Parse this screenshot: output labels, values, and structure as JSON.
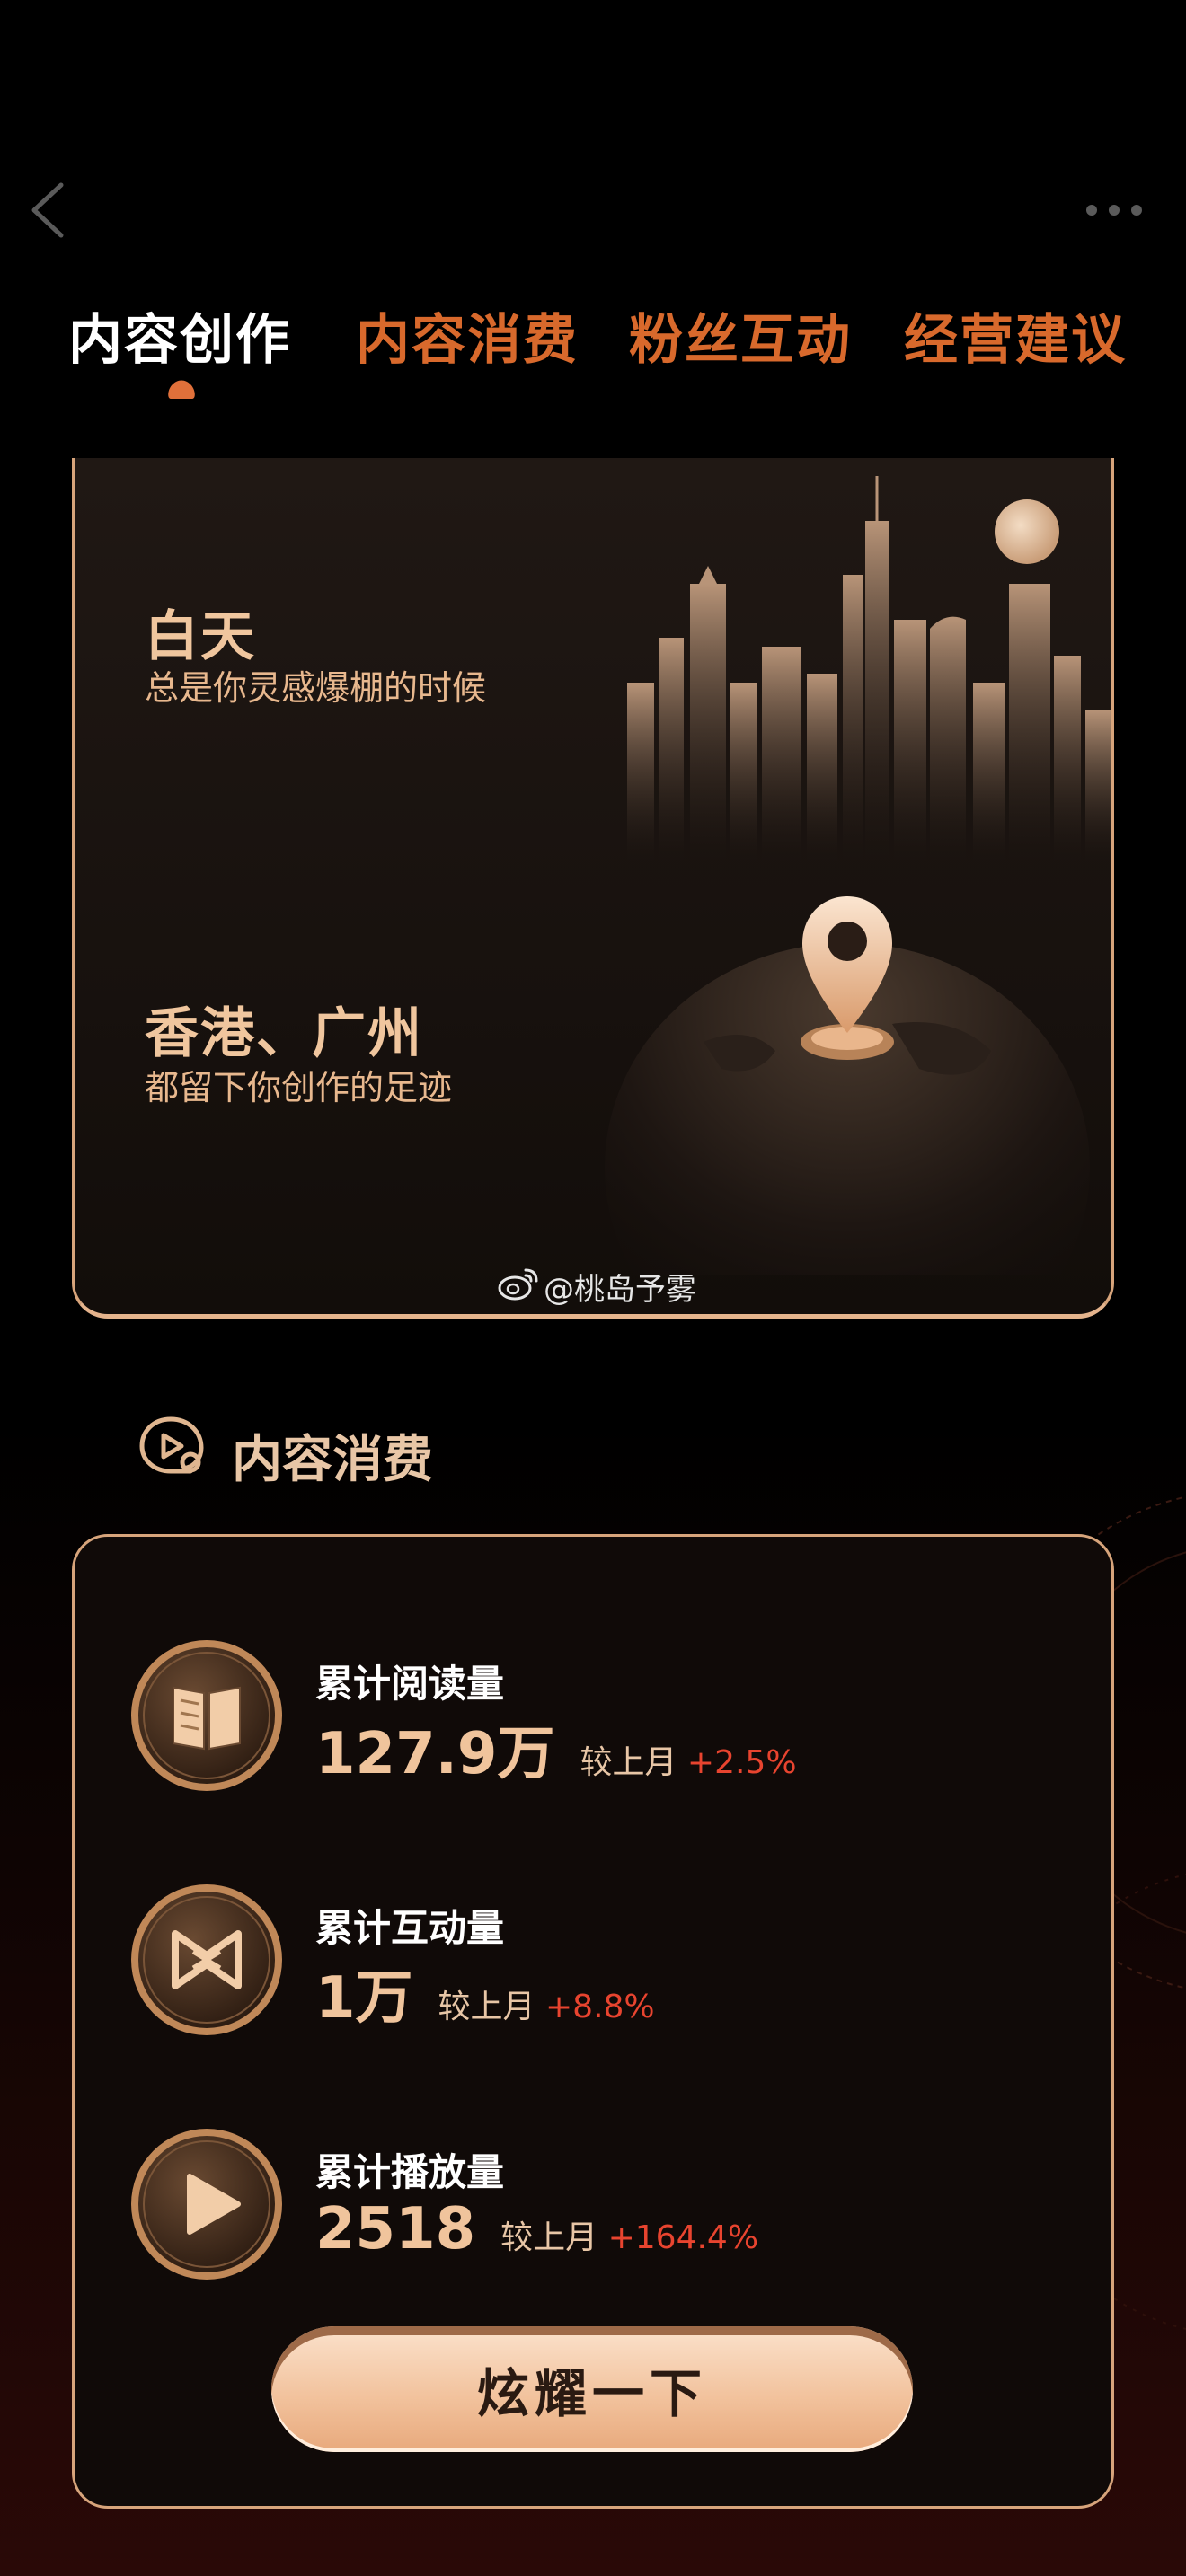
{
  "nav": {
    "back_icon": "chevron-left-icon",
    "more_icon": "more-horizontal-icon",
    "tabs": [
      {
        "label": "内容创作",
        "active": true
      },
      {
        "label": "内容消费",
        "active": false
      },
      {
        "label": "粉丝互动",
        "active": false
      },
      {
        "label": "经营建议",
        "active": false
      }
    ]
  },
  "creation_card": {
    "daytime_title": "白天",
    "daytime_subtitle": "总是你灵感爆棚的时候",
    "location_title": "香港、广州",
    "location_subtitle": "都留下你创作的足迹",
    "watermark": "@桃岛予雾"
  },
  "consumption": {
    "section_title": "内容消费",
    "stats": [
      {
        "label": "累计阅读量",
        "value": "127.9万",
        "compare": "较上月",
        "change": "+2.5%",
        "icon": "book-icon"
      },
      {
        "label": "累计互动量",
        "value": "1万",
        "compare": "较上月",
        "change": "+8.8%",
        "icon": "interaction-icon"
      },
      {
        "label": "累计播放量",
        "value": "2518",
        "compare": "较上月",
        "change": "+164.4%",
        "icon": "play-icon"
      }
    ],
    "cta_label": "炫耀一下"
  },
  "colors": {
    "accent_orange": "#d8692c",
    "gold": "#e4b38c",
    "increase_red": "#e8442f"
  }
}
